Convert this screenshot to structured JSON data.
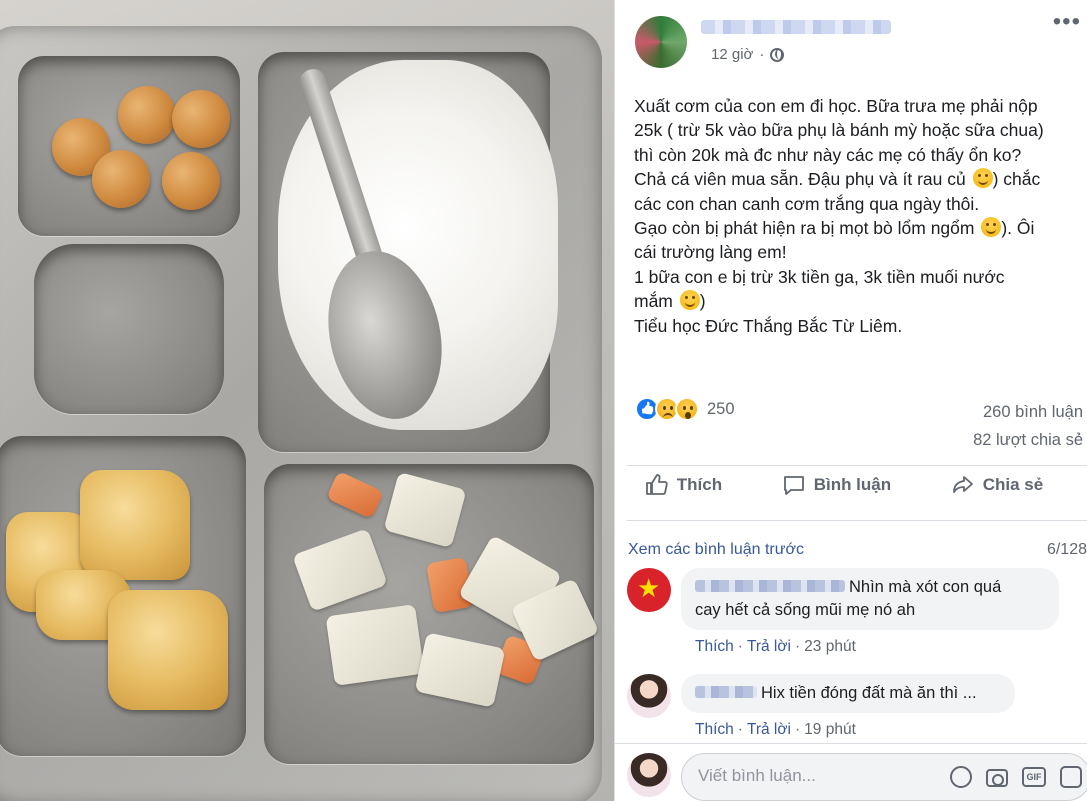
{
  "post": {
    "time": "12 giờ",
    "more": "•••",
    "text_lines": [
      "Xuất cơm của con em đi học. Bữa trưa mẹ phải nộp",
      "25k ( trừ 5k vào bữa phụ là bánh mỳ hoặc sữa chua)",
      "thì còn 20k mà đc như này các mẹ có thấy ổn ko?",
      "Chả cá viên mua sẵn. Đậu phụ và ít rau củ",
      ") chắc",
      "các con chan canh cơm trắng qua ngày thôi.",
      "Gạo còn bị phát hiện ra bị mọt bò lổm ngổm",
      "). Ôi",
      "cái trường làng em!",
      "1 bữa con e bị trừ 3k tiền ga, 3k tiền muối nước",
      "mắm",
      ")",
      "Tiểu học Đức Thắng Bắc Từ Liêm."
    ],
    "reaction_count": "250",
    "comments_count": "260 bình luận",
    "shares_count": "82 lượt chia sẻ"
  },
  "actions": {
    "like": "Thích",
    "comment": "Bình luận",
    "share": "Chia sẻ"
  },
  "comments": {
    "see_previous": "Xem các bình luận trước",
    "counter": "6/128",
    "items": [
      {
        "text_line1": "Nhìn mà xót con quá",
        "text_line2": "cay hết cả sống mũi mẹ nó ah",
        "like": "Thích",
        "reply": "Trả lời",
        "time": "23 phút"
      },
      {
        "text_line1": "Hix tiền đóng đất mà ăn thì ...",
        "like": "Thích",
        "reply": "Trả lời",
        "time": "19 phút"
      }
    ],
    "composer_placeholder": "Viết bình luận...",
    "gif_label": "GIF"
  },
  "colors": {
    "link": "#385898",
    "muted": "#606770",
    "brand": "#1877f2"
  }
}
